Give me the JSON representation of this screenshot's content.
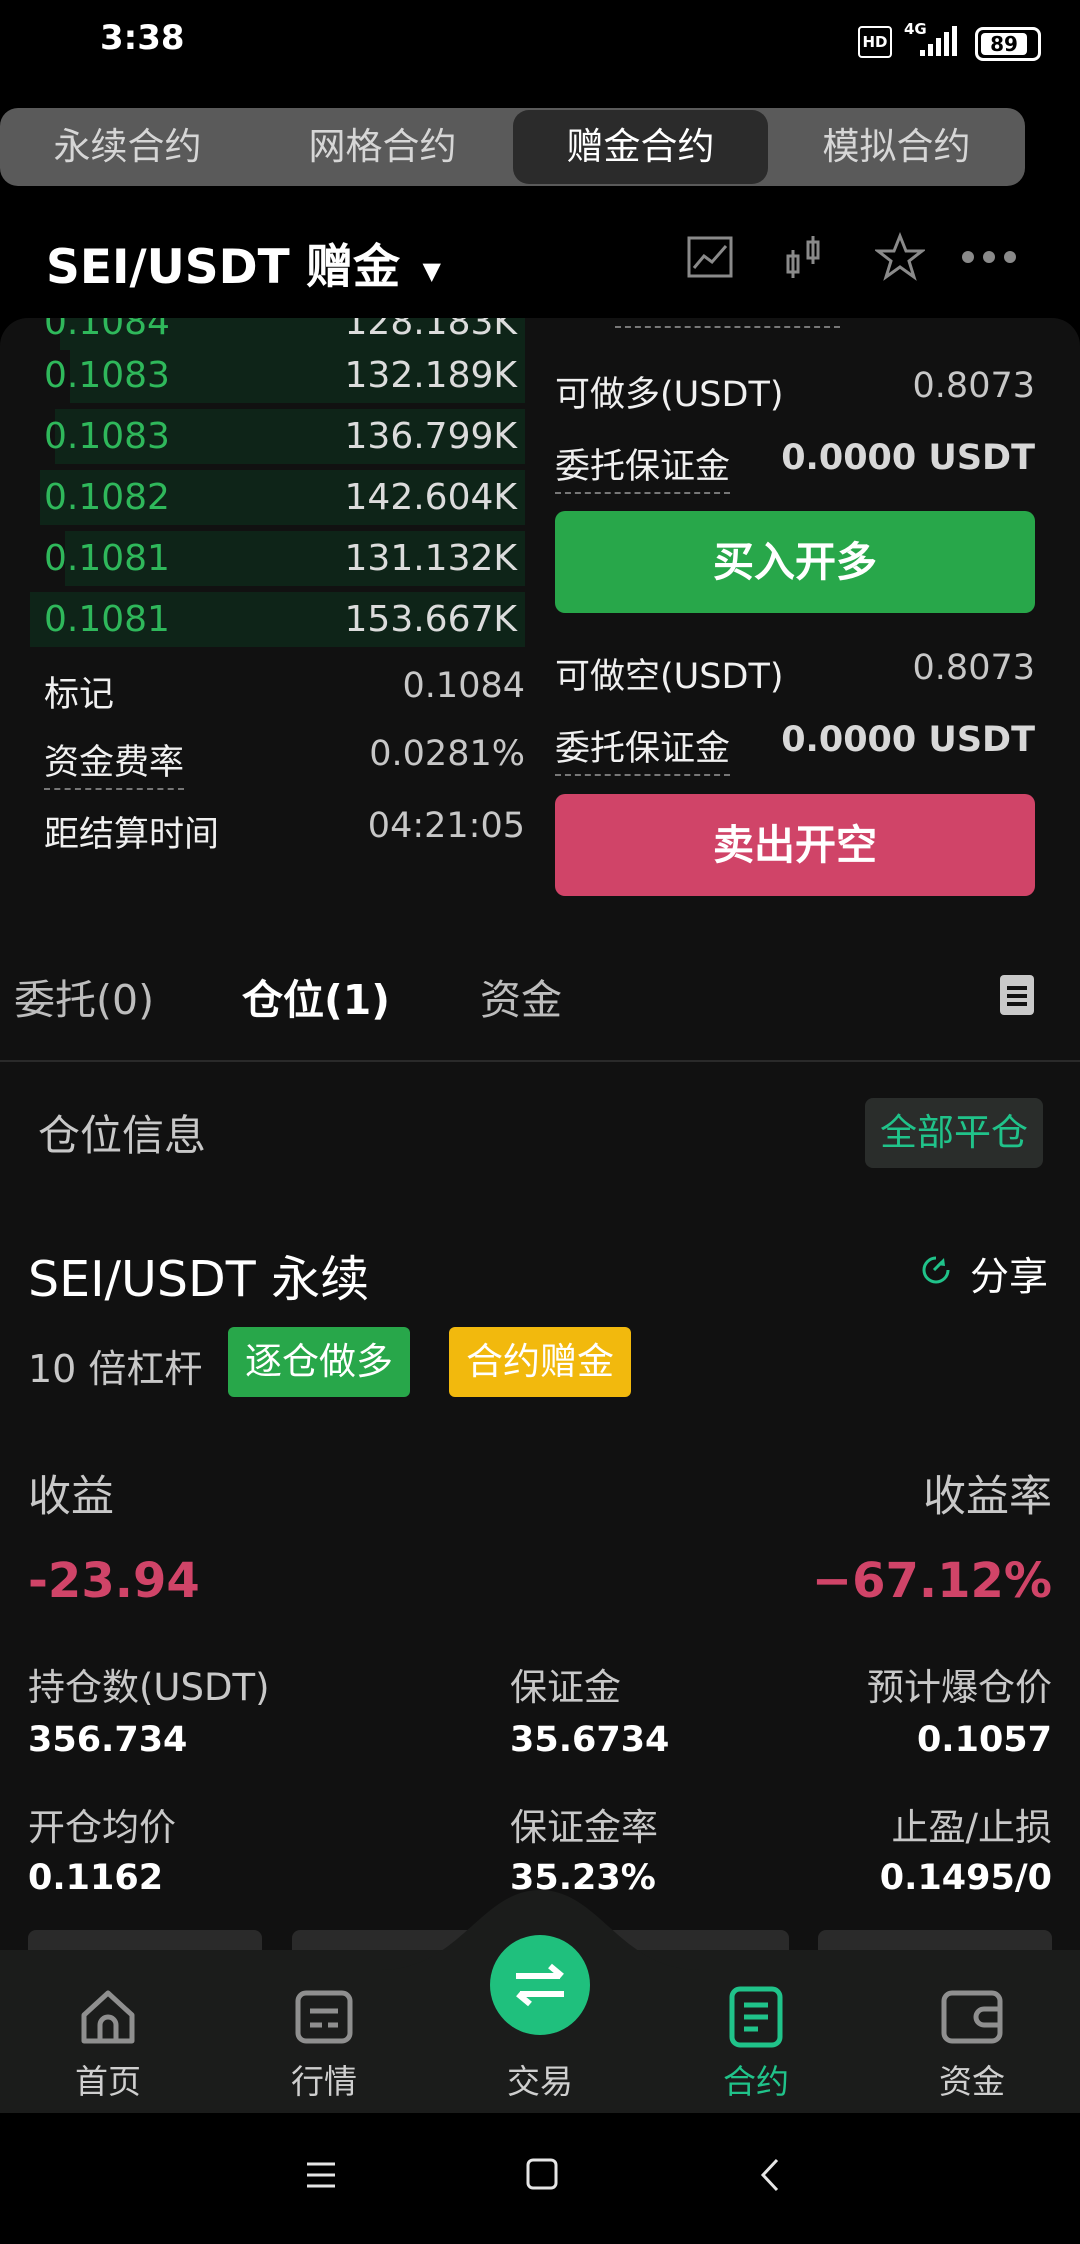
{
  "status": {
    "time": "3:38",
    "hd": "HD",
    "network": "4G",
    "battery": "89"
  },
  "tabs": [
    {
      "label": "永续合约",
      "active": false
    },
    {
      "label": "网格合约",
      "active": false
    },
    {
      "label": "赠金合约",
      "active": true
    },
    {
      "label": "模拟合约",
      "active": false
    }
  ],
  "pair": {
    "title": "SEI/USDT  赠金"
  },
  "orderbook": {
    "partial_row": {
      "price": "0.1084",
      "qty": "128.183K"
    },
    "rows": [
      {
        "price": "0.1083",
        "qty": "132.189K"
      },
      {
        "price": "0.1083",
        "qty": "136.799K"
      },
      {
        "price": "0.1082",
        "qty": "142.604K"
      },
      {
        "price": "0.1081",
        "qty": "131.132K"
      },
      {
        "price": "0.1081",
        "qty": "153.667K"
      }
    ]
  },
  "market_info": {
    "mark_label": "标记",
    "mark_value": "0.1084",
    "funding_label": "资金费率",
    "funding_value": "0.0281%",
    "settle_label": "距结算时间",
    "settle_value": "04:21:05"
  },
  "order_panel": {
    "long_avail_label": "可做多(USDT)",
    "long_avail_value": "0.8073",
    "long_margin_label": "委托保证金",
    "long_margin_value": "0.0000 USDT",
    "buy_button": "买入开多",
    "short_avail_label": "可做空(USDT)",
    "short_avail_value": "0.8073",
    "short_margin_label": "委托保证金",
    "short_margin_value": "0.0000 USDT",
    "sell_button": "卖出开空"
  },
  "position_tabs": {
    "orders": "委托(0)",
    "positions": "仓位(1)",
    "funds": "资金"
  },
  "position": {
    "section_title": "仓位信息",
    "close_all": "全部平仓",
    "symbol": "SEI/USDT 永续",
    "share": "分享",
    "leverage": "10 倍杠杆",
    "badge_mode": "逐仓做多",
    "badge_bonus": "合约赠金",
    "pnl_label": "收益",
    "pnl_value": "-23.94",
    "roe_label": "收益率",
    "roe_value": "−67.12%",
    "size_label": "持仓数(USDT)",
    "size_value": "356.734",
    "margin_label": "保证金",
    "margin_value": "35.6734",
    "liq_label": "预计爆仓价",
    "liq_value": "0.1057",
    "entry_label": "开仓均价",
    "entry_value": "0.1162",
    "margin_rate_label": "保证金率",
    "margin_rate_value": "35.23%",
    "tpsl_label": "止盈/止损",
    "tpsl_value": "0.1495/0"
  },
  "bottom_nav": [
    {
      "label": "首页",
      "icon": "home-icon"
    },
    {
      "label": "行情",
      "icon": "market-icon"
    },
    {
      "label": "交易",
      "icon": "swap-icon"
    },
    {
      "label": "合约",
      "icon": "contract-icon",
      "active": true
    },
    {
      "label": "资金",
      "icon": "wallet-icon"
    }
  ],
  "colors": {
    "green": "#2fb85b",
    "red": "#d04468",
    "accent": "#20c38a",
    "yellow": "#f2b90d"
  }
}
